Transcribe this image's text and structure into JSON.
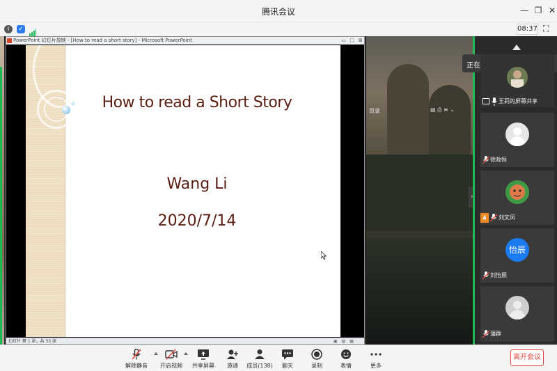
{
  "window": {
    "title": "腾讯会议",
    "time": "08:37"
  },
  "ppt": {
    "window_title": "PowerPoint 幻灯片放映 - [How to read a short story] - Microsoft PowerPoint",
    "status_text": "幻灯片 第 1 张，共 33 张",
    "slide": {
      "title": "How to read a Short Story",
      "author": "Wang Li",
      "date": "2020/7/14"
    }
  },
  "background": {
    "label": "目录"
  },
  "participants": {
    "speaking_label": "正在讲话:",
    "tiles": [
      {
        "name": "王莉的屏幕共享"
      },
      {
        "name": "徐政恒"
      },
      {
        "name": "刘文凤"
      },
      {
        "name": "刘怡辰",
        "avatar_text": "怡辰"
      },
      {
        "name": "蒲群"
      }
    ]
  },
  "toolbar": {
    "items": [
      {
        "label": "解除静音",
        "icon": "mic-muted-icon"
      },
      {
        "label": "开启视频",
        "icon": "camera-off-icon"
      },
      {
        "label": "共享屏幕",
        "icon": "screen-share-icon"
      },
      {
        "label": "邀请",
        "icon": "invite-icon"
      },
      {
        "label": "成员(138)",
        "icon": "members-icon"
      },
      {
        "label": "聊天",
        "icon": "chat-icon"
      },
      {
        "label": "录制",
        "icon": "record-icon"
      },
      {
        "label": "表情",
        "icon": "emoji-icon"
      },
      {
        "label": "更多",
        "icon": "more-icon"
      }
    ],
    "leave_label": "离开会议",
    "leave_color": "#e0483e"
  },
  "colors": {
    "accent_green": "#1db954",
    "slide_text": "#5a1e12"
  }
}
